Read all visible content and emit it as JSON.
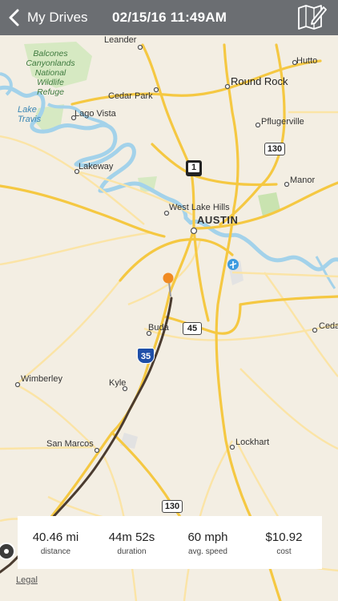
{
  "header": {
    "back_label": "My Drives",
    "title": "02/15/16 11:49AM"
  },
  "map": {
    "places": {
      "leander": "Leander",
      "balcones": "Balcones Canyonlands National Wildlife Refuge",
      "hutto": "Hutto",
      "round_rock": "Round Rock",
      "cedar_park": "Cedar Park",
      "lake_travis": "Lake Travis",
      "lago_vista": "Lago Vista",
      "pflugerville": "Pflugerville",
      "lakeway": "Lakeway",
      "manor": "Manor",
      "west_lake_hills": "West Lake Hills",
      "austin": "AUSTIN",
      "buda": "Buda",
      "ceda": "Ceda",
      "wimberley": "Wimberley",
      "kyle": "Kyle",
      "san_marcos": "San Marcos",
      "lockhart": "Lockhart"
    },
    "shields": {
      "sh130_top": "130",
      "sh1": "1",
      "sh45": "45",
      "i35": "35",
      "sh130_bottom": "130"
    },
    "colors": {
      "land": "#f3eee3",
      "water": "#a3d2ea",
      "major_road": "#f5c842",
      "minor_road": "#fbe4a6",
      "route": "#4a3b2f",
      "start_pin": "#f08a22"
    }
  },
  "stats": [
    {
      "value": "40.46 mi",
      "label": "distance"
    },
    {
      "value": "44m 52s",
      "label": "duration"
    },
    {
      "value": "60 mph",
      "label": "avg. speed"
    },
    {
      "value": "$10.92",
      "label": "cost"
    }
  ],
  "legal": "Legal"
}
